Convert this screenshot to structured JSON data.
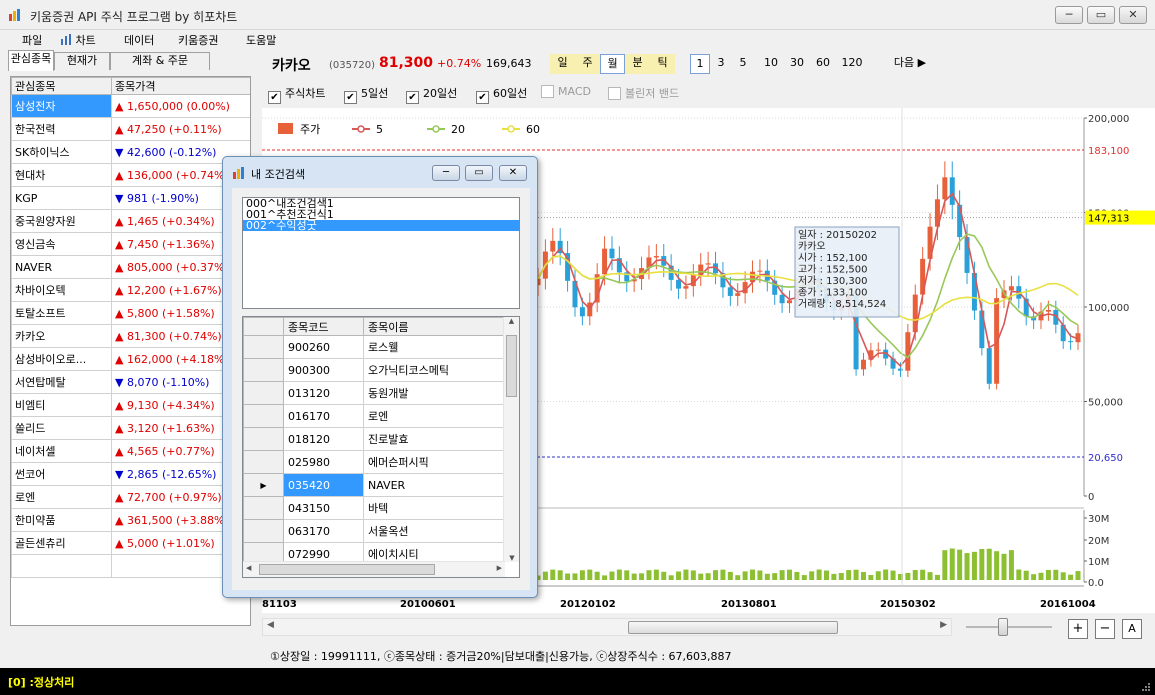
{
  "window": {
    "title": "키움증권 API 주식 프로그램 by 히포차트",
    "min": "─",
    "max": "▭",
    "close": "✕"
  },
  "menu": [
    "파일",
    "차트",
    "데이터",
    "키움증권",
    "도움말"
  ],
  "left_tabs": [
    "관심종목",
    "현재가",
    "계좌 & 주문"
  ],
  "watchlist": {
    "headers": [
      "관심종목",
      "종목가격"
    ],
    "rows": [
      {
        "name": "삼성전자",
        "dir": "up",
        "price": "1,650,000 (0.00%)"
      },
      {
        "name": "한국전력",
        "dir": "up",
        "price": "47,250 (+0.11%)"
      },
      {
        "name": "SK하이닉스",
        "dir": "down",
        "price": "42,600 (-0.12%)"
      },
      {
        "name": "현대차",
        "dir": "up",
        "price": "136,000 (+0.74%)"
      },
      {
        "name": "KGP",
        "dir": "down",
        "price": "981 (-1.90%)"
      },
      {
        "name": "중국원양자원",
        "dir": "up",
        "price": "1,465 (+0.34%)"
      },
      {
        "name": "영신금속",
        "dir": "up",
        "price": "7,450 (+1.36%)"
      },
      {
        "name": "NAVER",
        "dir": "up",
        "price": "805,000 (+0.37%)"
      },
      {
        "name": "차바이오텍",
        "dir": "up",
        "price": "12,200 (+1.67%)"
      },
      {
        "name": "토탈소프트",
        "dir": "up",
        "price": "5,800 (+1.58%)"
      },
      {
        "name": "카카오",
        "dir": "up",
        "price": "81,300 (+0.74%)"
      },
      {
        "name": "삼성바이오로...",
        "dir": "up",
        "price": "162,000 (+4.18%)"
      },
      {
        "name": "서연탑메탈",
        "dir": "down",
        "price": "8,070 (-1.10%)"
      },
      {
        "name": "비엠티",
        "dir": "up",
        "price": "9,130 (+4.34%)"
      },
      {
        "name": "쏠리드",
        "dir": "up",
        "price": "3,120 (+1.63%)"
      },
      {
        "name": "네이처셀",
        "dir": "up",
        "price": "4,565 (+0.77%)"
      },
      {
        "name": "썬코어",
        "dir": "down",
        "price": "2,865 (-12.65%)"
      },
      {
        "name": "로엔",
        "dir": "up",
        "price": "72,700 (+0.97%)"
      },
      {
        "name": "한미약품",
        "dir": "up",
        "price": "361,500 (+3.88%)"
      },
      {
        "name": "골든센츄리",
        "dir": "up",
        "price": "5,000 (+1.01%)"
      }
    ]
  },
  "stock": {
    "name": "카카오",
    "code": "(035720)",
    "price": "81,300",
    "change": "+0.74%",
    "volume": "169,643",
    "periods": [
      "일",
      "주",
      "월",
      "분",
      "틱"
    ],
    "counts": [
      "1",
      "3",
      "5",
      "10",
      "30",
      "60",
      "120"
    ],
    "next": "다음 ▶"
  },
  "checks": [
    {
      "label": "주식차트",
      "checked": true
    },
    {
      "label": "5일선",
      "checked": true
    },
    {
      "label": "20일선",
      "checked": true
    },
    {
      "label": "60일선",
      "checked": true
    },
    {
      "label": "MACD",
      "checked": false
    },
    {
      "label": "볼린저 밴드",
      "checked": false
    }
  ],
  "legend": [
    "주가",
    "5",
    "20",
    "60"
  ],
  "colors": {
    "up": "#e8603a",
    "down": "#2aa0d8",
    "ma5": "#d85858",
    "ma20": "#98c858",
    "ma60": "#e8e040",
    "vol": "#8cc032",
    "accent": "#3399ff"
  },
  "axis": {
    "price_ticks": [
      "200,000",
      "150,000",
      "100,000",
      "50,000",
      "0"
    ],
    "hi_label": "183,100",
    "cur_label": "147,313",
    "lo_label": "20,650",
    "vol_ticks": [
      "30M",
      "20M",
      "10M",
      "0.0"
    ],
    "dates": [
      "81103",
      "20100601",
      "20120102",
      "20130801",
      "20150302",
      "20161004"
    ]
  },
  "tooltip": [
    "일자 : 20150202",
    "카카오",
    "시가 : 152,100",
    "고가 : 152,500",
    "저가 : 130,300",
    "종가 : 133,100",
    "거래량 : 8,514,524"
  ],
  "toolbar": {
    "plus": "+",
    "minus": "−",
    "auto": "A"
  },
  "info": "①상장일 : 19991111, ⓒ종목상태 : 증거금20%|담보대출|신용가능, ⓒ상장주식수 : 67,603,887",
  "status": "[0] :정상처리",
  "dialog": {
    "title": "내 조건검색",
    "conditions": [
      "000^내조건검색1",
      "001^추천조건식1",
      "002^수익성굿"
    ],
    "headers": [
      "종목코드",
      "종목이름"
    ],
    "rows": [
      {
        "code": "900260",
        "name": "로스웰"
      },
      {
        "code": "900300",
        "name": "오가닉티코스메틱"
      },
      {
        "code": "013120",
        "name": "동원개발"
      },
      {
        "code": "016170",
        "name": "로엔"
      },
      {
        "code": "018120",
        "name": "진로발효"
      },
      {
        "code": "025980",
        "name": "에머슨퍼시픽"
      },
      {
        "code": "035420",
        "name": "NAVER"
      },
      {
        "code": "043150",
        "name": "바텍"
      },
      {
        "code": "063170",
        "name": "서울옥션"
      },
      {
        "code": "072990",
        "name": "에이치시티"
      }
    ]
  }
}
